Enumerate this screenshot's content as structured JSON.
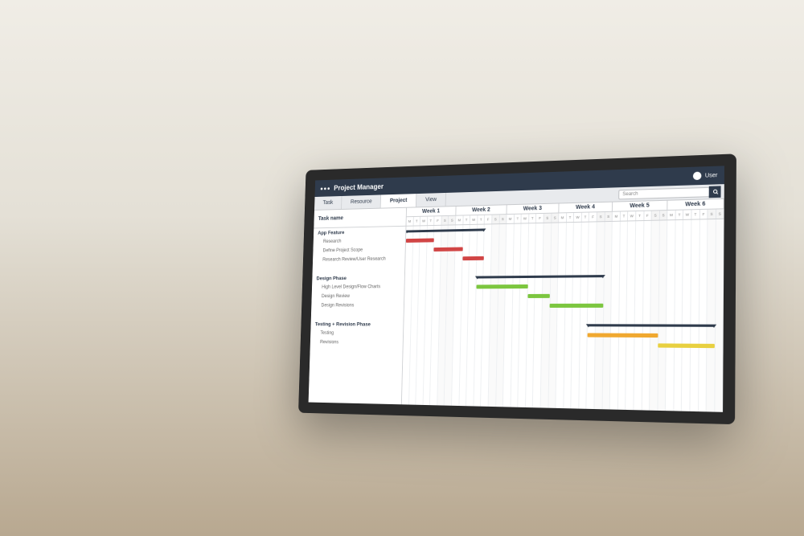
{
  "app": {
    "title": "Project Manager",
    "user_label": "User"
  },
  "tabs": [
    {
      "label": "Task"
    },
    {
      "label": "Resource"
    },
    {
      "label": "Project",
      "active": true
    },
    {
      "label": "View"
    }
  ],
  "search": {
    "placeholder": "Search"
  },
  "task_column_header": "Task name",
  "weeks": [
    "Week 1",
    "Week 2",
    "Week 3",
    "Week 4",
    "Week 5",
    "Week 6"
  ],
  "days": [
    "M",
    "T",
    "W",
    "T",
    "F",
    "S",
    "S"
  ],
  "tasks": [
    {
      "name": "App Feature",
      "type": "group",
      "start": 0,
      "end": 11
    },
    {
      "name": "Research",
      "type": "child",
      "color": "red",
      "start": 0,
      "end": 4
    },
    {
      "name": "Define Project Scope",
      "type": "child",
      "color": "red",
      "start": 4,
      "end": 8
    },
    {
      "name": "Research Review/User Research",
      "type": "child",
      "color": "red",
      "start": 8,
      "end": 11
    },
    {
      "name": "",
      "type": "spacer"
    },
    {
      "name": "Design Phase",
      "type": "group",
      "start": 10,
      "end": 27
    },
    {
      "name": "High Level Design/Flow Charts",
      "type": "child",
      "color": "green",
      "start": 10,
      "end": 17
    },
    {
      "name": "Design Review",
      "type": "child",
      "color": "green",
      "start": 17,
      "end": 20
    },
    {
      "name": "Design Revisions",
      "type": "child",
      "color": "green",
      "start": 20,
      "end": 27
    },
    {
      "name": "",
      "type": "spacer"
    },
    {
      "name": "Testing + Revision Phase",
      "type": "group",
      "start": 25,
      "end": 41
    },
    {
      "name": "Testing",
      "type": "child",
      "color": "orange",
      "start": 25,
      "end": 34
    },
    {
      "name": "Revisions",
      "type": "child",
      "color": "yellow",
      "start": 34,
      "end": 41
    }
  ],
  "chart_data": {
    "type": "gantt",
    "title": "Project Manager Timeline",
    "x_unit": "day",
    "columns_per_week": 7,
    "weeks": 6,
    "groups": [
      {
        "name": "App Feature",
        "span": [
          0,
          11
        ],
        "tasks": [
          {
            "name": "Research",
            "span": [
              0,
              4
            ],
            "color": "#d14545"
          },
          {
            "name": "Define Project Scope",
            "span": [
              4,
              8
            ],
            "color": "#d14545"
          },
          {
            "name": "Research Review/User Research",
            "span": [
              8,
              11
            ],
            "color": "#d14545"
          }
        ]
      },
      {
        "name": "Design Phase",
        "span": [
          10,
          27
        ],
        "tasks": [
          {
            "name": "High Level Design/Flow Charts",
            "span": [
              10,
              17
            ],
            "color": "#7cc63f"
          },
          {
            "name": "Design Review",
            "span": [
              17,
              20
            ],
            "color": "#7cc63f"
          },
          {
            "name": "Design Revisions",
            "span": [
              20,
              27
            ],
            "color": "#7cc63f"
          }
        ]
      },
      {
        "name": "Testing + Revision Phase",
        "span": [
          25,
          41
        ],
        "tasks": [
          {
            "name": "Testing",
            "span": [
              25,
              34
            ],
            "color": "#f0a830"
          },
          {
            "name": "Revisions",
            "span": [
              34,
              41
            ],
            "color": "#e8d040"
          }
        ]
      }
    ]
  }
}
